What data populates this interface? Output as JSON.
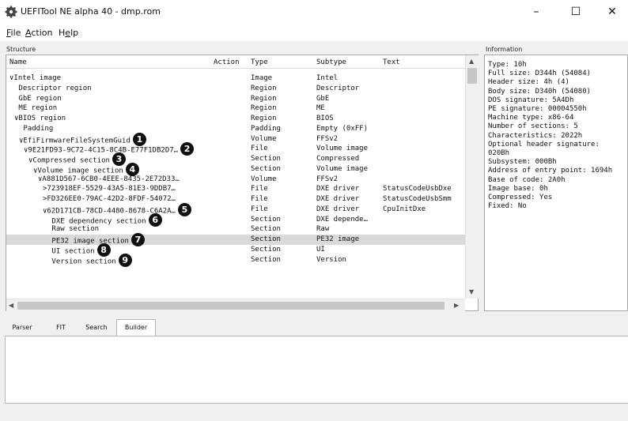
{
  "window": {
    "title": "UEFITool NE alpha 40 - dmp.rom",
    "app_icon": "gear-icon",
    "min_glyph": "–",
    "max_glyph": "☐",
    "close_glyph": "✕"
  },
  "menu": [
    {
      "accel": "F",
      "rest": "ile"
    },
    {
      "accel": "A",
      "rest": "ction"
    },
    {
      "pre": "H",
      "accel": "e",
      "rest": "lp"
    }
  ],
  "structure": {
    "label": "Structure",
    "columns": [
      "Name",
      "Action",
      "Type",
      "Subtype",
      "Text"
    ],
    "rows": [
      {
        "prefix": "∨",
        "name": "Intel image",
        "action": "",
        "type": "Image",
        "subtype": "Intel",
        "text": "",
        "badge": ""
      },
      {
        "prefix": "",
        "name": "Descriptor region",
        "action": "",
        "type": "Region",
        "subtype": "Descriptor",
        "text": "",
        "badge": ""
      },
      {
        "prefix": "",
        "name": "GbE region",
        "action": "",
        "type": "Region",
        "subtype": "GbE",
        "text": "",
        "badge": ""
      },
      {
        "prefix": "",
        "name": "ME region",
        "action": "",
        "type": "Region",
        "subtype": "ME",
        "text": "",
        "badge": ""
      },
      {
        "prefix": "∨",
        "name": "BIOS region",
        "action": "",
        "type": "Region",
        "subtype": "BIOS",
        "text": "",
        "badge": ""
      },
      {
        "prefix": "",
        "name": "Padding",
        "action": "",
        "type": "Padding",
        "subtype": "Empty (0xFF)",
        "text": "",
        "badge": ""
      },
      {
        "prefix": "∨",
        "name": "EfiFirmwareFileSystemGuid",
        "action": "",
        "type": "Volume",
        "subtype": "FFSv2",
        "text": "",
        "badge": "1"
      },
      {
        "prefix": "∨",
        "name": "9E21FD93-9C72-4C15-8C4B-E77F1DB2D7…",
        "action": "",
        "type": "File",
        "subtype": "Volume image",
        "text": "",
        "badge": "2"
      },
      {
        "prefix": "∨",
        "name": "Compressed section",
        "action": "",
        "type": "Section",
        "subtype": "Compressed",
        "text": "",
        "badge": "3"
      },
      {
        "prefix": "∨",
        "name": "Volume image section",
        "action": "",
        "type": "Section",
        "subtype": "Volume image",
        "text": "",
        "badge": "4"
      },
      {
        "prefix": "∨",
        "name": "A881D567-6CB0-4EEE-8435-2E72D33…",
        "action": "",
        "type": "Volume",
        "subtype": "FFSv2",
        "text": "",
        "badge": ""
      },
      {
        "prefix": ">",
        "name": "723918EF-5529-43A5-81E3-9DDB7…",
        "action": "",
        "type": "File",
        "subtype": "DXE driver",
        "text": "StatusCodeUsbDxe",
        "badge": ""
      },
      {
        "prefix": ">",
        "name": "FD326EE0-79AC-42D2-8FDF-54072…",
        "action": "",
        "type": "File",
        "subtype": "DXE driver",
        "text": "StatusCodeUsbSmm",
        "badge": ""
      },
      {
        "prefix": "∨",
        "name": "62D171CB-78CD-4480-8678-C6A2A…",
        "action": "",
        "type": "File",
        "subtype": "DXE driver",
        "text": "CpuInitDxe",
        "badge": "5"
      },
      {
        "prefix": "",
        "name": "DXE dependency section",
        "action": "",
        "type": "Section",
        "subtype": "DXE depende…",
        "text": "",
        "badge": "6"
      },
      {
        "prefix": "",
        "name": "Raw section",
        "action": "",
        "type": "Section",
        "subtype": "Raw",
        "text": "",
        "badge": ""
      },
      {
        "prefix": "",
        "name": "PE32 image section",
        "action": "",
        "type": "Section",
        "subtype": "PE32 image",
        "text": "",
        "badge": "7"
      },
      {
        "prefix": "",
        "name": "UI section",
        "action": "",
        "type": "Section",
        "subtype": "UI",
        "text": "",
        "badge": "8"
      },
      {
        "prefix": "",
        "name": "Version section",
        "action": "",
        "type": "Section",
        "subtype": "Version",
        "text": "",
        "badge": "9"
      }
    ],
    "selected_row": 16
  },
  "information": {
    "label": "Information",
    "text": "Type: 10h\nFull size: D344h (54084)\nHeader size: 4h (4)\nBody size: D340h (54080)\nDOS signature: 5A4Dh\nPE signature: 00004550h\nMachine type: x86-64\nNumber of sections: 5\nCharacteristics: 2022h\nOptional header signature:\n020Bh\nSubsystem: 000Bh\nAddress of entry point: 1694h\nBase of code: 2A0h\nImage base: 0h\nCompressed: Yes\nFixed: No"
  },
  "tabs": [
    "Parser",
    "FIT",
    "Search",
    "Builder"
  ],
  "active_tab": "Builder"
}
